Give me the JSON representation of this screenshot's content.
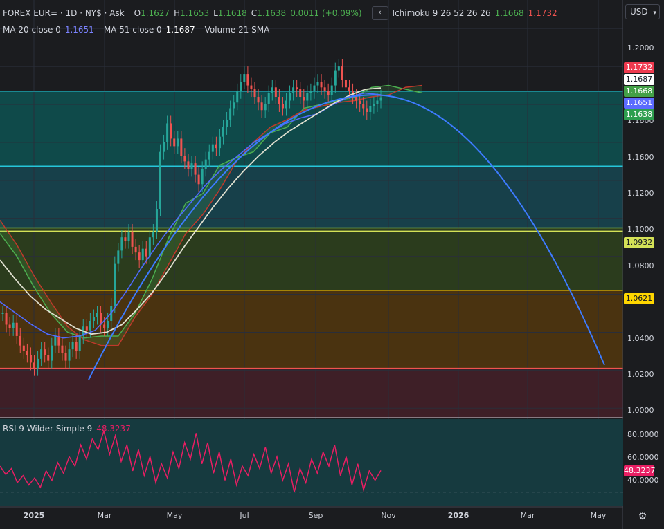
{
  "header": {
    "symbol": "FOREX EUR= · 1D · NY$ · Ask",
    "o_label": "O",
    "o_value": "1.1627",
    "h_label": "H",
    "h_value": "1.1653",
    "l_label": "L",
    "l_value": "1.1618",
    "c_label": "C",
    "c_value": "1.1638",
    "change": "0.0011 (+0.09%)",
    "collapse_icon": "chevron-left-icon",
    "ichimoku_label": "Ichimoku 9 26 52 26 26",
    "ichimoku_v1": "1.1668",
    "ichimoku_v2": "1.1732"
  },
  "indicators": {
    "ma20_label": "MA 20 close 0",
    "ma20_value": "1.1651",
    "ma51_label": "MA 51 close 0",
    "ma51_value": "1.1687",
    "volume_label": "Volume 21 SMA"
  },
  "currency": "USD",
  "price_axis": {
    "ticks": [
      "1.2000",
      "1.1800",
      "1.1600",
      "1.1400",
      "1.1200",
      "1.1000",
      "1.0800",
      "1.0600",
      "1.0400",
      "1.0200",
      "1.0000"
    ],
    "labels": [
      {
        "text": "1.1732",
        "color": "#ef3a4f",
        "fg": "#ffffff"
      },
      {
        "text": "1.1687",
        "color": "#ffffff",
        "fg": "#131722"
      },
      {
        "text": "1.1668",
        "color": "#43a047",
        "fg": "#ffffff"
      },
      {
        "text": "1.1651",
        "color": "#5c6bff",
        "fg": "#ffffff"
      },
      {
        "text": "1.1638",
        "color": "#2e9e4f",
        "fg": "#ffffff"
      },
      {
        "text": "1.0932",
        "color": "#d4e157",
        "fg": "#131722"
      },
      {
        "text": "1.0621",
        "color": "#ffd600",
        "fg": "#131722"
      }
    ]
  },
  "rsi": {
    "label": "RSI 9 Wilder Simple 9",
    "value": "48.3237",
    "ticks": [
      "80.0000",
      "60.0000",
      "40.0000"
    ],
    "level_lines": [
      70,
      30
    ]
  },
  "time_axis": {
    "labels": [
      "2025",
      "Mar",
      "May",
      "Jul",
      "Sep",
      "Nov",
      "2026",
      "Mar",
      "May"
    ],
    "settings_icon": "gear-icon"
  },
  "chart_data": {
    "type": "candlestick",
    "symbol": "EUR=",
    "interval": "1D",
    "ylim": [
      0.995,
      1.215
    ],
    "horizontal_levels": [
      {
        "price": 1.167,
        "color": "#26c6da"
      },
      {
        "price": 1.1275,
        "color": "#26c6da"
      },
      {
        "price": 1.095,
        "color": "#8bc34a"
      },
      {
        "price": 1.0932,
        "color": "#d4e157"
      },
      {
        "price": 1.0621,
        "color": "#ffd600"
      },
      {
        "price": 1.021,
        "color": "#ef5350"
      }
    ],
    "zones": [
      {
        "from": 1.167,
        "to": 1.1275,
        "color": "#0f4a4a"
      },
      {
        "from": 1.1275,
        "to": 1.095,
        "color": "#17404a"
      },
      {
        "from": 1.095,
        "to": 1.0621,
        "color": "#2b3c1d"
      },
      {
        "from": 1.0621,
        "to": 1.021,
        "color": "#4a3310"
      },
      {
        "from": 1.021,
        "to": 0.995,
        "color": "#3e1f27"
      }
    ],
    "closes": [
      1.05,
      1.044,
      1.042,
      1.045,
      1.038,
      1.033,
      1.03,
      1.028,
      1.024,
      1.021,
      1.026,
      1.031,
      1.028,
      1.025,
      1.033,
      1.038,
      1.033,
      1.029,
      1.025,
      1.031,
      1.035,
      1.03,
      1.038,
      1.043,
      1.041,
      1.046,
      1.048,
      1.05,
      1.044,
      1.042,
      1.046,
      1.054,
      1.076,
      1.083,
      1.09,
      1.088,
      1.093,
      1.085,
      1.082,
      1.078,
      1.084,
      1.08,
      1.09,
      1.093,
      1.105,
      1.135,
      1.14,
      1.15,
      1.142,
      1.138,
      1.142,
      1.133,
      1.13,
      1.126,
      1.129,
      1.123,
      1.118,
      1.126,
      1.131,
      1.135,
      1.139,
      1.137,
      1.143,
      1.148,
      1.152,
      1.158,
      1.161,
      1.167,
      1.172,
      1.176,
      1.17,
      1.168,
      1.164,
      1.161,
      1.157,
      1.16,
      1.166,
      1.169,
      1.164,
      1.16,
      1.158,
      1.162,
      1.166,
      1.169,
      1.168,
      1.164,
      1.162,
      1.166,
      1.167,
      1.17,
      1.172,
      1.169,
      1.167,
      1.165,
      1.17,
      1.178,
      1.18,
      1.173,
      1.169,
      1.167,
      1.164,
      1.162,
      1.16,
      1.158,
      1.156,
      1.159,
      1.16,
      1.162,
      1.1638
    ],
    "ma20": [
      1.056,
      1.05,
      1.044,
      1.039,
      1.037,
      1.038,
      1.041,
      1.05,
      1.062,
      1.075,
      1.087,
      1.098,
      1.108,
      1.118,
      1.126,
      1.133,
      1.14,
      1.145,
      1.15,
      1.153,
      1.155,
      1.16,
      1.164,
      1.166,
      1.1651
    ],
    "ma51": [
      1.078,
      1.068,
      1.059,
      1.052,
      1.047,
      1.042,
      1.039,
      1.04,
      1.044,
      1.052,
      1.061,
      1.072,
      1.084,
      1.095,
      1.106,
      1.116,
      1.125,
      1.133,
      1.14,
      1.146,
      1.151,
      1.156,
      1.161,
      1.165,
      1.168,
      1.1687
    ],
    "ichimoku_span_a": [
      1.092,
      1.08,
      1.064,
      1.05,
      1.04,
      1.037,
      1.038,
      1.038,
      1.05,
      1.068,
      1.09,
      1.108,
      1.113,
      1.128,
      1.132,
      1.135,
      1.145,
      1.148,
      1.158,
      1.16,
      1.162,
      1.164,
      1.169,
      1.17,
      1.168,
      1.166
    ],
    "ichimoku_span_b": [
      1.099,
      1.086,
      1.07,
      1.056,
      1.043,
      1.036,
      1.033,
      1.033,
      1.048,
      1.06,
      1.076,
      1.092,
      1.102,
      1.115,
      1.13,
      1.14,
      1.148,
      1.152,
      1.157,
      1.159,
      1.161,
      1.162,
      1.164,
      1.165,
      1.169,
      1.17
    ],
    "trend_curve": {
      "type": "parabolic",
      "start_price": 1.015,
      "peak_price": 1.165,
      "end_price": 1.021
    },
    "rsi_values": [
      52,
      45,
      50,
      38,
      44,
      36,
      42,
      34,
      48,
      40,
      55,
      46,
      60,
      52,
      70,
      58,
      75,
      66,
      82,
      62,
      78,
      56,
      70,
      48,
      66,
      44,
      60,
      38,
      54,
      42,
      64,
      50,
      72,
      58,
      80,
      54,
      72,
      46,
      64,
      40,
      58,
      36,
      52,
      44,
      62,
      50,
      68,
      46,
      60,
      40,
      54,
      30,
      50,
      38,
      58,
      46,
      64,
      52,
      70,
      44,
      60,
      36,
      54,
      32,
      48,
      40,
      48.3237
    ]
  }
}
